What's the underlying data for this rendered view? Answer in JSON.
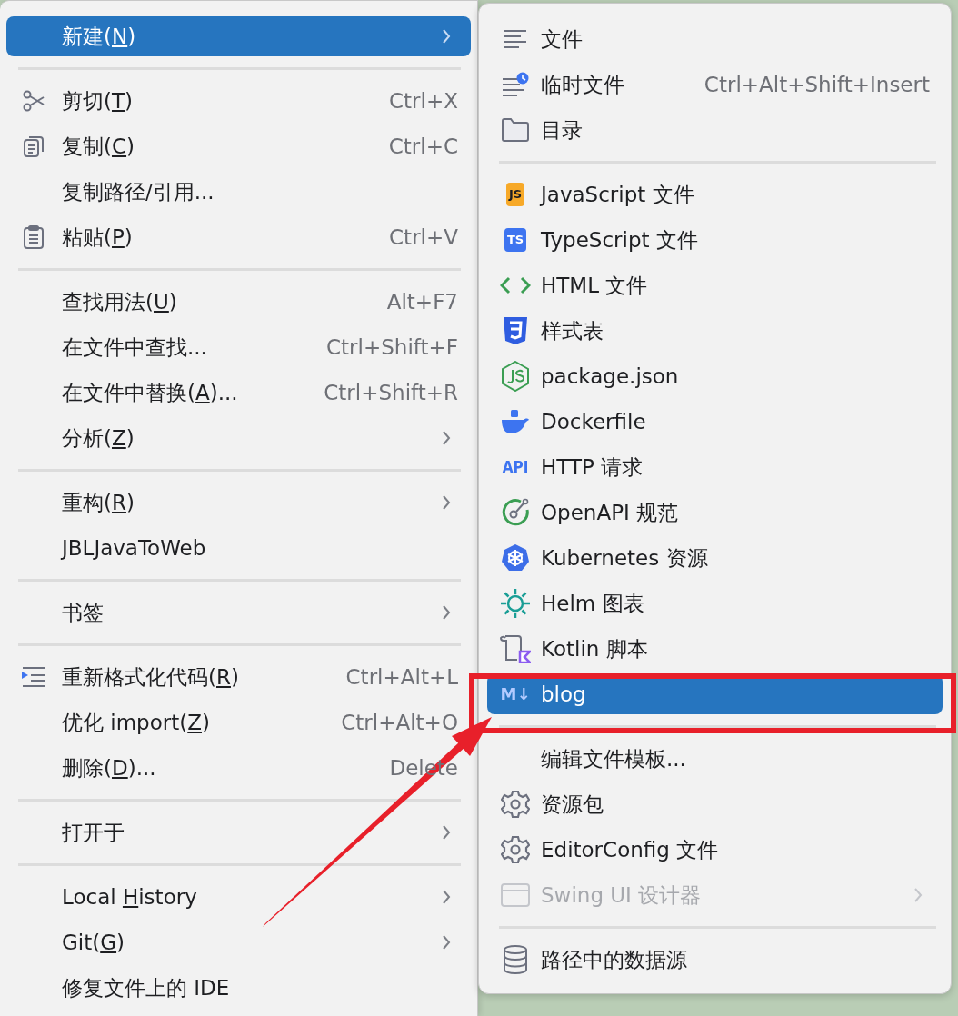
{
  "context_menu": {
    "items": [
      {
        "kind": "item",
        "label": "新建(",
        "mnemonic": "N",
        "after": ")",
        "selected": true,
        "submenu": true
      },
      {
        "kind": "separator"
      },
      {
        "kind": "item",
        "label": "剪切(",
        "mnemonic": "T",
        "after": ")",
        "shortcut": "Ctrl+X",
        "selected": false,
        "submenu": false
      },
      {
        "kind": "item",
        "label": "复制(",
        "mnemonic": "C",
        "after": ")",
        "shortcut": "Ctrl+C",
        "selected": false,
        "submenu": false
      },
      {
        "kind": "item",
        "label": "复制路径/引用...",
        "selected": false,
        "submenu": false
      },
      {
        "kind": "item",
        "label": "粘贴(",
        "mnemonic": "P",
        "after": ")",
        "shortcut": "Ctrl+V",
        "selected": false,
        "submenu": false
      },
      {
        "kind": "separator"
      },
      {
        "kind": "item",
        "label": "查找用法(",
        "mnemonic": "U",
        "after": ")",
        "shortcut": "Alt+F7",
        "selected": false,
        "submenu": false
      },
      {
        "kind": "item",
        "label": "在文件中查找...",
        "shortcut": "Ctrl+Shift+F",
        "selected": false,
        "submenu": false
      },
      {
        "kind": "item",
        "label": "在文件中替换(",
        "mnemonic": "A",
        "after": ")...",
        "shortcut": "Ctrl+Shift+R",
        "selected": false,
        "submenu": false
      },
      {
        "kind": "item",
        "label": "分析(",
        "mnemonic": "Z",
        "after": ")",
        "selected": false,
        "submenu": true
      },
      {
        "kind": "separator"
      },
      {
        "kind": "item",
        "label": "重构(",
        "mnemonic": "R",
        "after": ")",
        "selected": false,
        "submenu": true
      },
      {
        "kind": "item",
        "label": "JBLJavaToWeb",
        "selected": false,
        "submenu": false
      },
      {
        "kind": "separator"
      },
      {
        "kind": "item",
        "label": "书签",
        "selected": false,
        "submenu": true
      },
      {
        "kind": "separator"
      },
      {
        "kind": "item",
        "label": "重新格式化代码(",
        "mnemonic": "R",
        "after": ")",
        "shortcut": "Ctrl+Alt+L",
        "selected": false,
        "submenu": false
      },
      {
        "kind": "item",
        "label": "优化 import(",
        "mnemonic": "Z",
        "after": ")",
        "shortcut": "Ctrl+Alt+O",
        "selected": false,
        "submenu": false
      },
      {
        "kind": "item",
        "label": "删除(",
        "mnemonic": "D",
        "after": ")...",
        "shortcut": "Delete",
        "selected": false,
        "submenu": false
      },
      {
        "kind": "separator"
      },
      {
        "kind": "item",
        "label": "打开于",
        "selected": false,
        "submenu": true
      },
      {
        "kind": "separator"
      },
      {
        "kind": "item",
        "label": "Local ",
        "mnemonic": "H",
        "after": "istory",
        "selected": false,
        "submenu": true
      },
      {
        "kind": "item",
        "label": "Git(",
        "mnemonic": "G",
        "after": ")",
        "selected": false,
        "submenu": true
      },
      {
        "kind": "item",
        "label": "修复文件上的 IDE",
        "selected": false,
        "submenu": false
      }
    ]
  },
  "new_submenu": {
    "items": [
      {
        "kind": "item",
        "label": "文件",
        "selected": false,
        "disabled": false,
        "submenu": false
      },
      {
        "kind": "item",
        "label": "临时文件",
        "shortcut": "Ctrl+Alt+Shift+Insert",
        "selected": false,
        "disabled": false,
        "submenu": false
      },
      {
        "kind": "item",
        "label": "目录",
        "selected": false,
        "disabled": false,
        "submenu": false
      },
      {
        "kind": "separator"
      },
      {
        "kind": "item",
        "label": "JavaScript 文件",
        "badge": "JS",
        "selected": false,
        "disabled": false,
        "submenu": false
      },
      {
        "kind": "item",
        "label": "TypeScript 文件",
        "badge": "TS",
        "selected": false,
        "disabled": false,
        "submenu": false
      },
      {
        "kind": "item",
        "label": "HTML 文件",
        "selected": false,
        "disabled": false,
        "submenu": false
      },
      {
        "kind": "item",
        "label": "样式表",
        "selected": false,
        "disabled": false,
        "submenu": false
      },
      {
        "kind": "item",
        "label": "package.json",
        "selected": false,
        "disabled": false,
        "submenu": false
      },
      {
        "kind": "item",
        "label": "Dockerfile",
        "selected": false,
        "disabled": false,
        "submenu": false
      },
      {
        "kind": "item",
        "label": "HTTP 请求",
        "badge": "API",
        "selected": false,
        "disabled": false,
        "submenu": false
      },
      {
        "kind": "item",
        "label": "OpenAPI 规范",
        "selected": false,
        "disabled": false,
        "submenu": false
      },
      {
        "kind": "item",
        "label": "Kubernetes 资源",
        "selected": false,
        "disabled": false,
        "submenu": false
      },
      {
        "kind": "item",
        "label": "Helm 图表",
        "selected": false,
        "disabled": false,
        "submenu": false
      },
      {
        "kind": "item",
        "label": "Kotlin 脚本",
        "selected": false,
        "disabled": false,
        "submenu": false
      },
      {
        "kind": "item",
        "label": "blog",
        "badge": "M↓",
        "selected": true,
        "disabled": false,
        "submenu": false
      },
      {
        "kind": "separator"
      },
      {
        "kind": "item",
        "label": "编辑文件模板...",
        "selected": false,
        "disabled": false,
        "submenu": false
      },
      {
        "kind": "item",
        "label": "资源包",
        "selected": false,
        "disabled": false,
        "submenu": false
      },
      {
        "kind": "item",
        "label": "EditorConfig 文件",
        "selected": false,
        "disabled": false,
        "submenu": false
      },
      {
        "kind": "item",
        "label": "Swing UI 设计器",
        "selected": false,
        "disabled": true,
        "submenu": true
      },
      {
        "kind": "separator"
      },
      {
        "kind": "item",
        "label": "路径中的数据源",
        "selected": false,
        "disabled": false,
        "submenu": false
      }
    ]
  }
}
